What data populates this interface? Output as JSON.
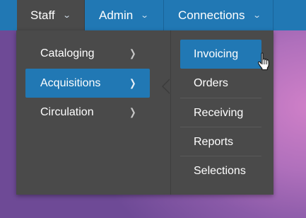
{
  "navbar": {
    "tabs": [
      {
        "label": "Staff",
        "state": "open"
      },
      {
        "label": "Admin"
      },
      {
        "label": "Connections"
      }
    ],
    "chevron_icon": "chevron-down-icon",
    "color": "#2178b4"
  },
  "staff_menu": {
    "items": [
      {
        "label": "Cataloging",
        "icon": "chevron-right-icon"
      },
      {
        "label": "Acquisitions",
        "icon": "chevron-right-icon",
        "active": true
      },
      {
        "label": "Circulation",
        "icon": "chevron-right-icon"
      }
    ],
    "background": "#4a4a4a",
    "highlight": "#2178b4"
  },
  "acquisitions_submenu": {
    "items": [
      {
        "label": "Invoicing",
        "active": true
      },
      {
        "label": "Orders"
      },
      {
        "label": "Receiving"
      },
      {
        "label": "Reports"
      },
      {
        "label": "Selections"
      }
    ]
  },
  "cursor": {
    "icon": "hand-pointer-icon"
  }
}
